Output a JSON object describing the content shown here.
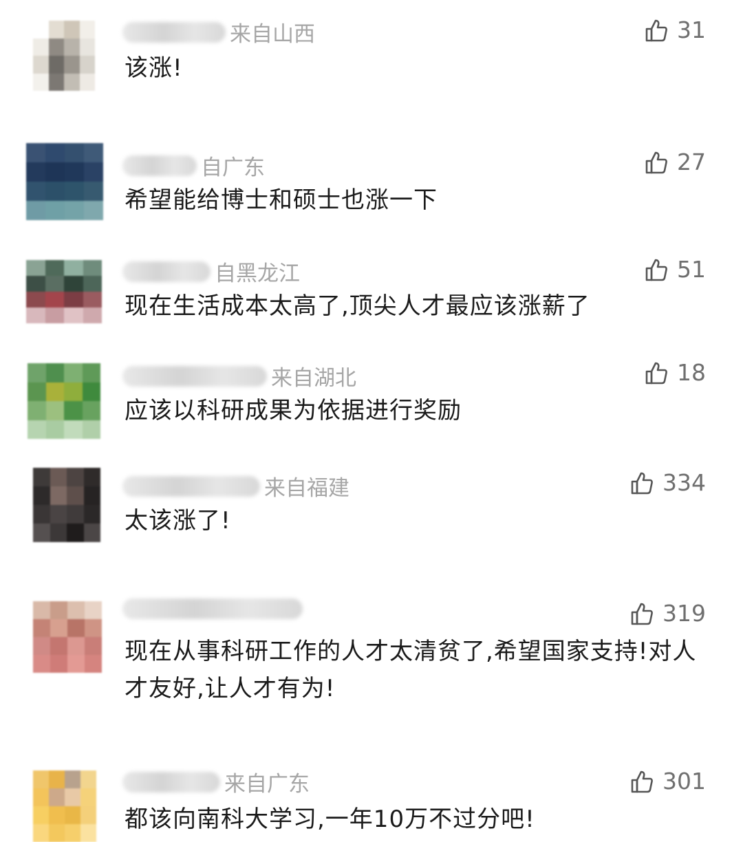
{
  "comments": [
    {
      "location": "来自山西",
      "text": "该涨!",
      "likes": "31",
      "avatar_colors": [
        "#ffffff",
        "#e3ddd2",
        "#cfc6b8",
        "#f2efe9",
        "#efece6",
        "#8f8a83",
        "#b8b3aa",
        "#e8e5df",
        "#ddd8cf",
        "#6e6b66",
        "#9a958d",
        "#d7d3cb",
        "#f3f1ec",
        "#7c7873",
        "#c2bdb4",
        "#eeeae4"
      ]
    },
    {
      "location": "自广东",
      "text": "希望能给博士和硕士也涨一下",
      "likes": "27",
      "avatar_colors": [
        "#3a5273",
        "#2f4a6e",
        "#34506f",
        "#3f5a78",
        "#233a5c",
        "#1e3557",
        "#20385a",
        "#2a4265",
        "#31536e",
        "#2c5069",
        "#2e546b",
        "#375a70",
        "#6f9ba5",
        "#6fa0a6",
        "#74a3a8",
        "#7fa8ad"
      ]
    },
    {
      "location": "自黑龙江",
      "text": "现在生活成本太高了,顶尖人才最应该涨薪了",
      "likes": "51",
      "avatar_colors": [
        "#8aa394",
        "#4f6a5a",
        "#90b0a0",
        "#6f8c7c",
        "#3d4f46",
        "#5a6e62",
        "#2f4439",
        "#4d6659",
        "#8c4a4e",
        "#a3454c",
        "#7c3d44",
        "#9a5b60",
        "#d8b8bc",
        "#c89da2",
        "#e0c2c5",
        "#cfa9ad"
      ]
    },
    {
      "location": "来自湖北",
      "text": "应该以科研成果为依据进行奖励",
      "likes": "18",
      "avatar_colors": [
        "#6fa36a",
        "#4f8f4e",
        "#7eb072",
        "#5f9a58",
        "#5b9550",
        "#a9b13a",
        "#8fae3c",
        "#3f8a3d",
        "#7fb072",
        "#9cc07f",
        "#4c9247",
        "#68a25f",
        "#b6d4b0",
        "#a9cca2",
        "#c1dbbb",
        "#b0cfa9"
      ]
    },
    {
      "location": "来自福建",
      "text": "太该涨了!",
      "likes": "334",
      "avatar_colors": [
        "#3e3a39",
        "#6b5a55",
        "#4d4442",
        "#2f2b2a",
        "#2d2a2a",
        "#7d6963",
        "#5e4f4b",
        "#262323",
        "#3a3636",
        "#4a4444",
        "#403b3b",
        "#2b2828",
        "#555050",
        "#3c3838",
        "#1f1c1c",
        "#4b4646"
      ]
    },
    {
      "location": "",
      "text": "现在从事科研工作的人才太清贫了,希望国家支持!对人才友好,让人才有为!",
      "likes": "319",
      "avatar_colors": [
        "#d9b9a8",
        "#c99d8a",
        "#dcbfae",
        "#e8d3c6",
        "#c48376",
        "#d7a08f",
        "#b87467",
        "#cf9485",
        "#d08a86",
        "#c47670",
        "#dc9891",
        "#c97e78",
        "#d98b87",
        "#cf7c78",
        "#e39a94",
        "#d5847f"
      ]
    },
    {
      "location": "来自广东",
      "text": "都该向南科大学习,一年10万不过分吧!",
      "likes": "301",
      "avatar_colors": [
        "#f0c66b",
        "#e8b34a",
        "#b8a28d",
        "#f2d58e",
        "#f3c45b",
        "#cda98a",
        "#e8c9a6",
        "#f5d27a",
        "#f7cf62",
        "#f0be4e",
        "#e9b747",
        "#f4d07a",
        "#fad77e",
        "#f3c85d",
        "#f6cf6b",
        "#fbe2a0"
      ]
    }
  ]
}
